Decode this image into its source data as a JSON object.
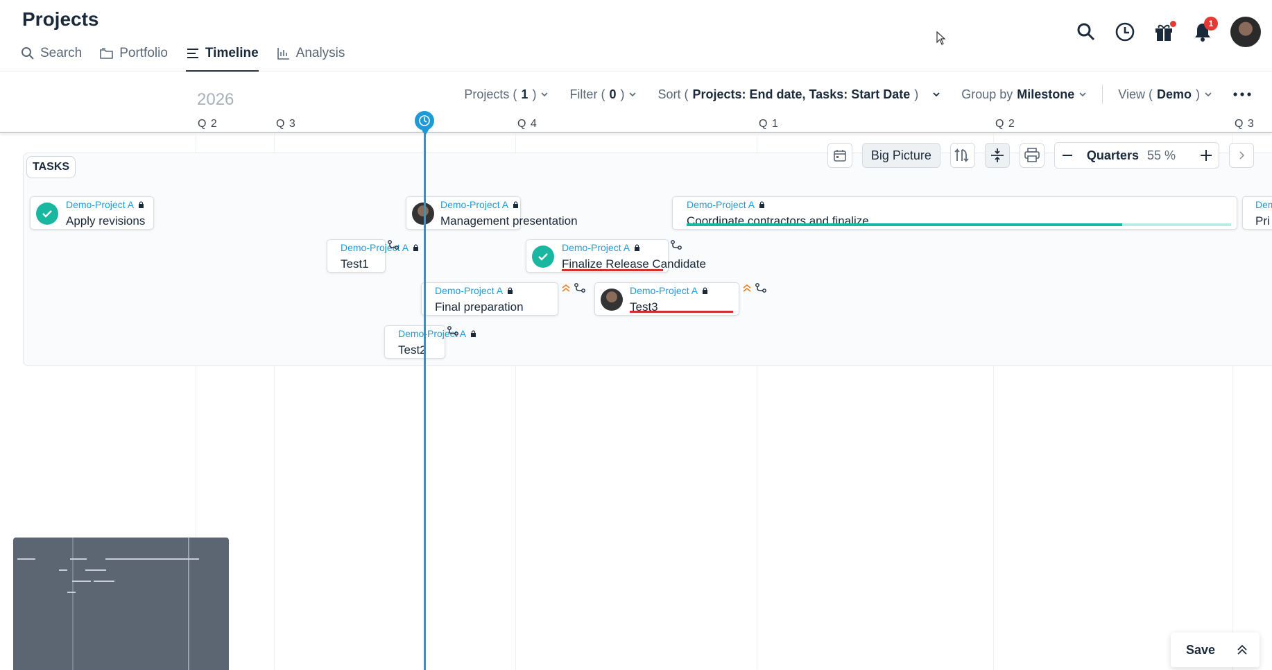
{
  "app": {
    "title": "Projects"
  },
  "tabs": [
    {
      "label": "Search",
      "icon": "search-icon"
    },
    {
      "label": "Portfolio",
      "icon": "folder-icon"
    },
    {
      "label": "Timeline",
      "icon": "list-icon",
      "active": true
    },
    {
      "label": "Analysis",
      "icon": "chart-icon"
    }
  ],
  "header_icons": {
    "search": "search-icon",
    "history": "clock-icon",
    "gift": "gift-icon",
    "notifications": "bell-icon",
    "notifications_count": "1",
    "avatar": "user-avatar"
  },
  "toolbar": {
    "projects_label": "Projects (",
    "projects_count": "1",
    "projects_close": ")",
    "filter_label": "Filter (",
    "filter_count": "0",
    "filter_close": ")",
    "sort_label": "Sort (",
    "sort_value": "Projects: End date, Tasks: Start Date",
    "sort_close": ")",
    "group_label": "Group by",
    "group_value": "Milestone",
    "view_label": "View (",
    "view_value": "Demo ",
    "view_close": ")"
  },
  "timeline": {
    "year": "2026",
    "quarters": [
      "Q 2",
      "Q 3",
      "Q 4",
      "Q 1",
      "Q 2",
      "Q 3"
    ]
  },
  "controls": {
    "big_picture": "Big Picture",
    "zoom_label": "Quarters",
    "zoom_percent": "55 %"
  },
  "tasks": {
    "label": "TASKS",
    "items": [
      {
        "project": "Demo-Project A",
        "name": "Apply revisions",
        "status": "done"
      },
      {
        "project": "Demo-Project A",
        "name": "Management presentation",
        "status": "assigned"
      },
      {
        "project": "Demo-Project A",
        "name": "Coordinate contractors and finalize",
        "status": "in-progress",
        "progress": 0.8
      },
      {
        "project": "Dem",
        "name": "Pri",
        "status": "cut-off"
      },
      {
        "project": "Demo-Project A",
        "name": "Test1",
        "status": "open"
      },
      {
        "project": "Demo-Project A",
        "name": "Finalize Release Candidate",
        "status": "done"
      },
      {
        "project": "Demo-Project A",
        "name": "Final preparation",
        "status": "open"
      },
      {
        "project": "Demo-Project A",
        "name": "Test3",
        "status": "assigned"
      },
      {
        "project": "Demo-Project A",
        "name": "Test2",
        "status": "open"
      }
    ]
  },
  "footer": {
    "save_label": "Save"
  },
  "colors": {
    "accent": "#1e9bd7",
    "done": "#19b6a0",
    "alert": "#d32f2f",
    "badge": "#e53935"
  }
}
